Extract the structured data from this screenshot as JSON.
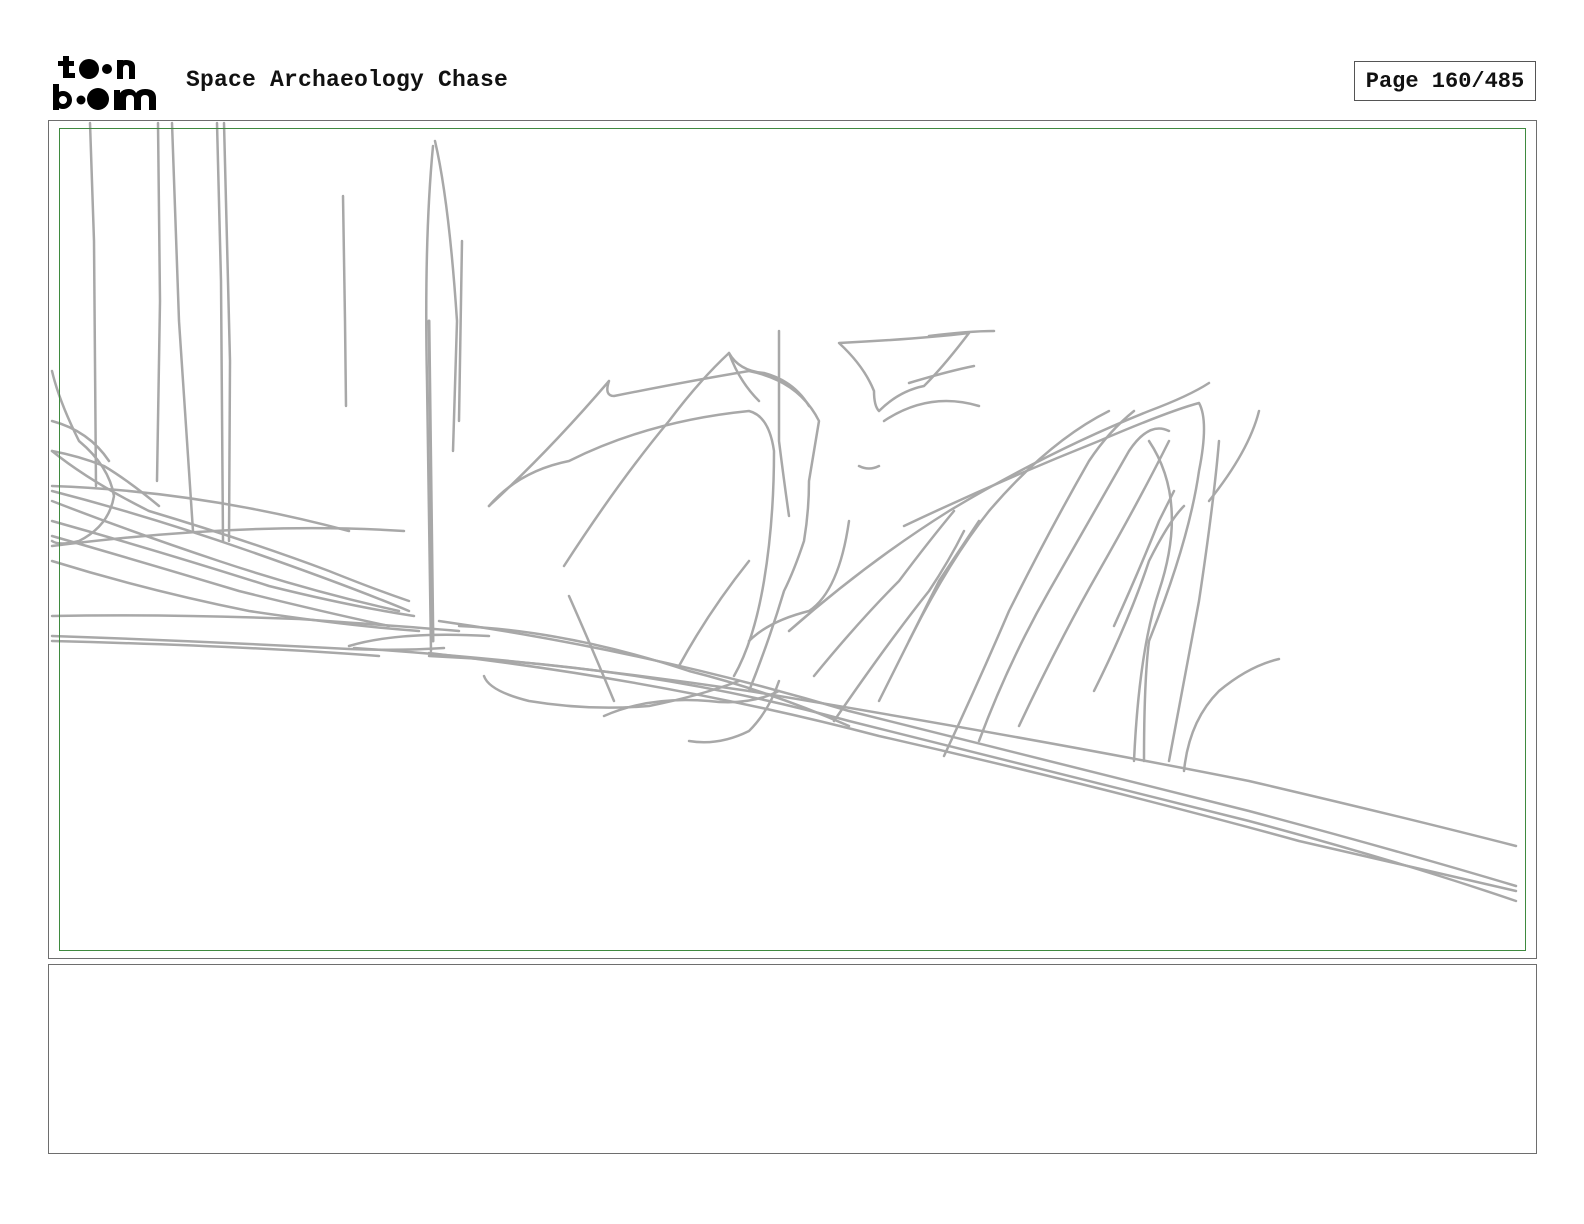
{
  "header": {
    "logo_text_top": "toon",
    "logo_text_bottom": "boom",
    "project_title": "Space Archaeology Chase",
    "page_label": "Page 160/485"
  },
  "panel": {
    "sketch_stroke_color": "#a8a8a8",
    "safe_area_color": "#3f8a3f",
    "frame_color": "#6e6e6e"
  },
  "notes": {
    "text": ""
  }
}
